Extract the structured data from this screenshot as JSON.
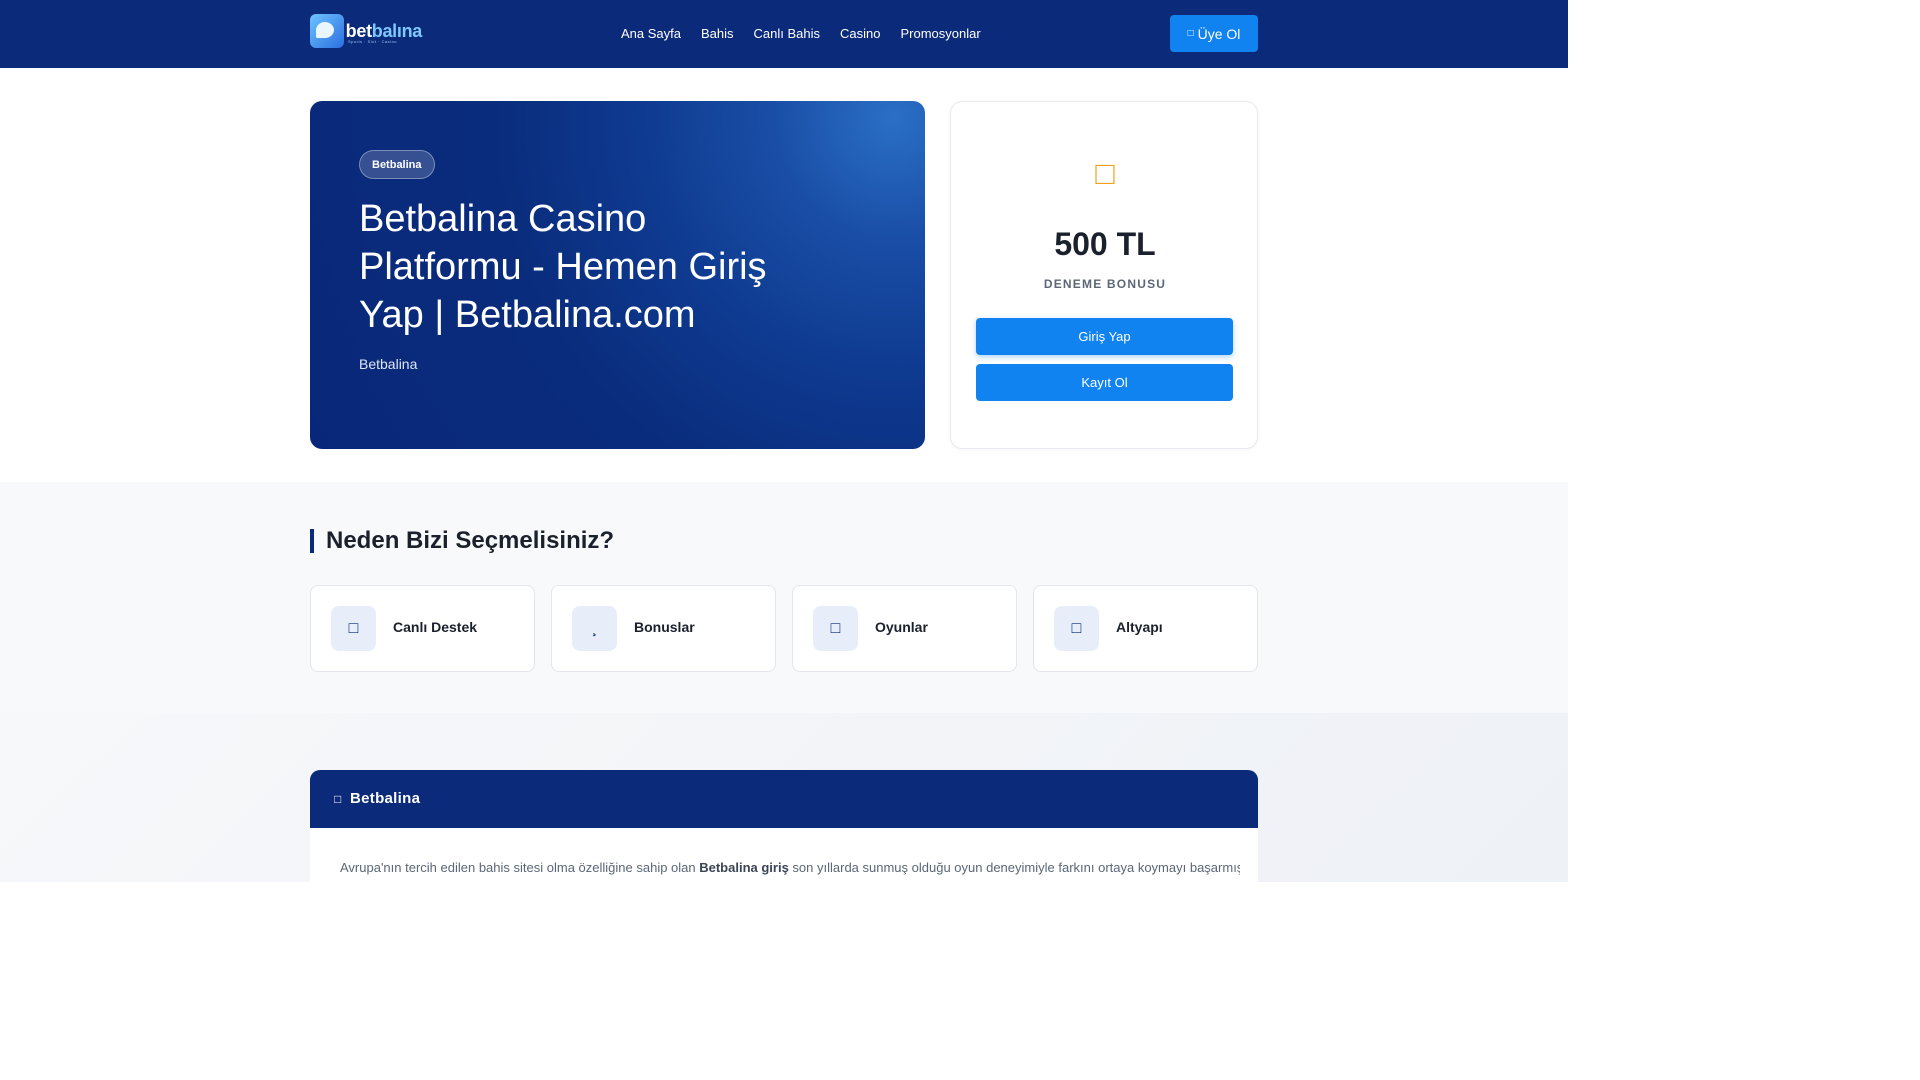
{
  "header": {
    "logo": {
      "brand_a": "bet",
      "brand_b": "balına",
      "tagline": "Sports · Slot · Casino"
    },
    "nav": [
      "Ana Sayfa",
      "Bahis",
      "Canlı Bahis",
      "Casino",
      "Promosyonlar"
    ],
    "signup_icon": "user-plus-icon",
    "signup_label": "Üye Ol"
  },
  "hero": {
    "badge": "Betbalina",
    "title": "Betbalina Casino Platformu - Hemen Giriş Yap | Betbalina.com",
    "subtitle": "Betbalina"
  },
  "bonus": {
    "icon": "gift-icon",
    "amount": "500 TL",
    "label": "DENEME BONUSU",
    "login_label": "Giriş Yap",
    "register_label": "Kayıt Ol"
  },
  "why": {
    "title": "Neden Bizi Seçmelisiniz?",
    "features": [
      {
        "icon": "headset-icon",
        "label": "Canlı Destek"
      },
      {
        "icon": "gift-icon",
        "label": "Bonuslar"
      },
      {
        "icon": "gamepad-icon",
        "label": "Oyunlar"
      },
      {
        "icon": "server-icon",
        "label": "Altyapı"
      }
    ]
  },
  "article": {
    "title": "Betbalina",
    "text_before": "Avrupa'nın tercih edilen bahis sitesi olma özelliğine sahip olan ",
    "text_bold": "Betbalina giriş",
    "text_after": " son yıllarda sunmuş olduğu oyun deneyimiyle farkını ortaya koymayı başarmış bir"
  },
  "colors": {
    "navy": "#0b2a7a",
    "accent_blue": "#1183f0",
    "gold": "#f0a11e"
  }
}
